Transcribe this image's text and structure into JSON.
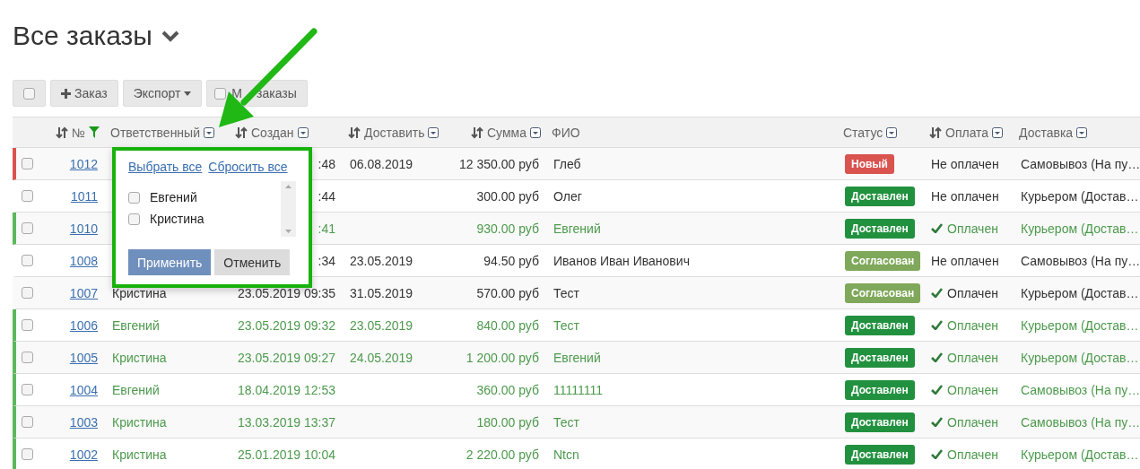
{
  "title": "Все заказы",
  "toolbar": [
    {
      "kind": "checkbox",
      "checked": false
    },
    {
      "kind": "add",
      "label": "Заказ"
    },
    {
      "kind": "dropdown",
      "label": "Экспорт"
    },
    {
      "kind": "toggle",
      "label_parts": [
        "М",
        "заказы"
      ],
      "checked": false
    }
  ],
  "table": {
    "columns": [
      {
        "label": "№",
        "sortable": true,
        "filter_menu": false,
        "filter_active": true
      },
      {
        "label": "Ответственный",
        "sortable": false,
        "filter_menu": true,
        "filter_active": false
      },
      {
        "label": "Создан",
        "sortable": true,
        "filter_menu": true,
        "filter_active": false
      },
      {
        "label": "Доставить",
        "sortable": true,
        "filter_menu": true,
        "filter_active": false
      },
      {
        "label": "Сумма",
        "sortable": true,
        "filter_menu": true,
        "filter_active": false
      },
      {
        "label": "ФИО",
        "sortable": false,
        "filter_menu": false,
        "filter_active": false
      },
      {
        "label": "Статус",
        "sortable": false,
        "filter_menu": true,
        "filter_active": false
      },
      {
        "label": "Оплата",
        "sortable": true,
        "filter_menu": true,
        "filter_active": false
      },
      {
        "label": "Доставка",
        "sortable": false,
        "filter_menu": true,
        "filter_active": false
      }
    ],
    "rows": [
      {
        "kind": "new",
        "checked": false,
        "number": "1012",
        "created": ":48",
        "deliver": "06.08.2019",
        "sum": "12 350.00 руб",
        "name": "Глеб",
        "status": {
          "label": "Новый",
          "kind": "new"
        },
        "payment": {
          "label": "Не оплачен",
          "paid": false
        },
        "delivery": "Самовывоз (На пу…"
      },
      {
        "kind": "regular",
        "checked": false,
        "number": "1011",
        "created": ":44",
        "sum": "300.00 руб",
        "name": "Олег",
        "status": {
          "label": "Доставлен",
          "kind": "delivered"
        },
        "payment": {
          "label": "Не оплачен",
          "paid": false
        },
        "delivery": "Курьером (Достав…"
      },
      {
        "kind": "completed",
        "checked": false,
        "number": "1010",
        "created": ":41",
        "sum": "930.00 руб",
        "name": "Евгений",
        "status": {
          "label": "Доставлен",
          "kind": "delivered"
        },
        "payment": {
          "label": "Оплачен",
          "paid": true
        },
        "delivery": "Курьером (Достав…"
      },
      {
        "kind": "regular",
        "checked": false,
        "number": "1008",
        "created": ":34",
        "deliver": "23.05.2019",
        "sum": "94.50 руб",
        "name": "Иванов Иван Иванович",
        "status": {
          "label": "Согласован",
          "kind": "agreed"
        },
        "payment": {
          "label": "Не оплачен",
          "paid": false
        },
        "delivery": "Самовывоз (На пу…"
      },
      {
        "kind": "regular",
        "checked": false,
        "number": "1007",
        "assignee": "Кристина",
        "created": "23.05.2019 09:35",
        "deliver": "31.05.2019",
        "sum": "570.00 руб",
        "name": "Тест",
        "status": {
          "label": "Согласован",
          "kind": "agreed"
        },
        "payment": {
          "label": "Оплачен",
          "paid": true
        },
        "delivery": "Курьером (Достав…"
      },
      {
        "kind": "completed",
        "checked": false,
        "number": "1006",
        "assignee": "Евгений",
        "created": "23.05.2019 09:32",
        "deliver": "23.05.2019",
        "sum": "840.00 руб",
        "name": "Тест",
        "status": {
          "label": "Доставлен",
          "kind": "delivered"
        },
        "payment": {
          "label": "Оплачен",
          "paid": true
        },
        "delivery": "Курьером (Достав…"
      },
      {
        "kind": "completed",
        "checked": false,
        "number": "1005",
        "assignee": "Кристина",
        "created": "23.05.2019 09:27",
        "deliver": "24.05.2019",
        "sum": "1 200.00 руб",
        "name": "Евгений",
        "status": {
          "label": "Доставлен",
          "kind": "delivered"
        },
        "payment": {
          "label": "Оплачен",
          "paid": true
        },
        "delivery": "Курьером (Достав…"
      },
      {
        "kind": "completed",
        "checked": false,
        "number": "1004",
        "assignee": "Евгений",
        "created": "18.04.2019 12:53",
        "sum": "360.00 руб",
        "name": "11111111",
        "status": {
          "label": "Доставлен",
          "kind": "delivered"
        },
        "payment": {
          "label": "Оплачен",
          "paid": true
        },
        "delivery": "Самовывоз (На пу…"
      },
      {
        "kind": "completed",
        "checked": false,
        "number": "1003",
        "assignee": "Кристина",
        "created": "13.03.2019 13:37",
        "sum": "180.00 руб",
        "name": "Тест",
        "status": {
          "label": "Доставлен",
          "kind": "delivered"
        },
        "payment": {
          "label": "Оплачен",
          "paid": true
        },
        "delivery": "Самовывоз (На пу…"
      },
      {
        "kind": "completed",
        "checked": false,
        "number": "1002",
        "assignee": "Кристина",
        "created": "25.01.2019 10:04",
        "sum": "2 220.00 руб",
        "name": "Ntcn",
        "status": {
          "label": "Доставлен",
          "kind": "delivered"
        },
        "payment": {
          "label": "Оплачен",
          "paid": true
        },
        "delivery": "Курьером (Достав…"
      }
    ]
  },
  "filter_popup": {
    "links": [
      "Выбрать все",
      "Сбросить все"
    ],
    "options": [
      {
        "label": "Евгений",
        "checked": false
      },
      {
        "label": "Кристина",
        "checked": false
      }
    ],
    "buttons": [
      {
        "label": "Применить",
        "kind": "primary"
      },
      {
        "label": "Отменить",
        "kind": "secondary"
      }
    ]
  }
}
